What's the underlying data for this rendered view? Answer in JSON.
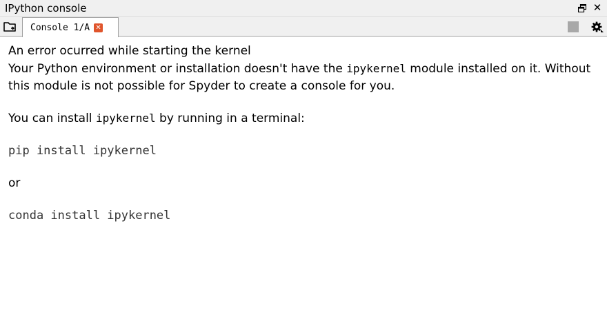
{
  "window": {
    "title": "IPython console"
  },
  "tabs": [
    {
      "label": "Console 1/A"
    }
  ],
  "icons": {
    "browse_tabs": "folder-browse-icon",
    "restore": "restore-window-icon",
    "close_window": "close-icon",
    "tab_close": "tab-close-icon",
    "stop": "stop-icon",
    "options": "gear-icon"
  },
  "colors": {
    "tab_close": "#e0552c",
    "stop_button": "#a8a8a8"
  },
  "message": {
    "heading": "An error ocurred while starting the kernel",
    "line1_prefix": "Your Python environment or installation doesn't have the ",
    "line1_module": "ipykernel",
    "line1_suffix": " module installed on it. Without this module is not possible for Spyder to create a console for you.",
    "install_prefix": "You can install ",
    "install_module": "ipykernel",
    "install_suffix": " by running in a terminal:",
    "pip_command": "pip install ipykernel",
    "or_text": "or",
    "conda_command": "conda install ipykernel"
  }
}
